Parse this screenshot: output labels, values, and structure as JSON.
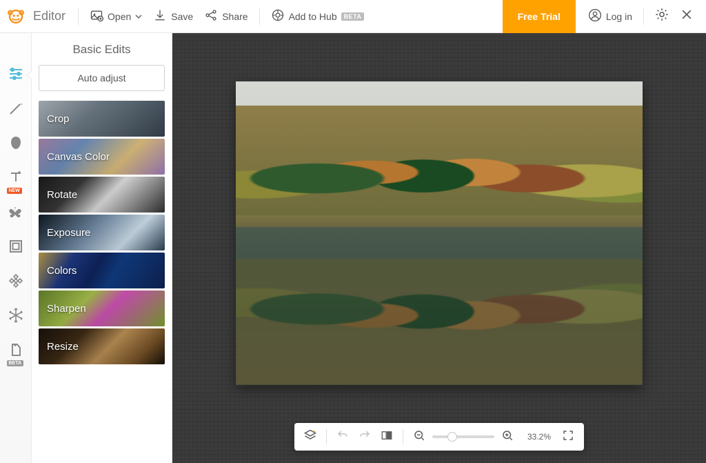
{
  "topbar": {
    "app_name": "Editor",
    "open_label": "Open",
    "save_label": "Save",
    "share_label": "Share",
    "hub_label": "Add to Hub",
    "hub_badge": "BETA",
    "trial_label": "Free Trial",
    "login_label": "Log in"
  },
  "rail": {
    "badges": {
      "new": "NEW",
      "beta": "BETA"
    }
  },
  "panel": {
    "title": "Basic Edits",
    "auto_label": "Auto adjust",
    "tiles": [
      {
        "key": "crop",
        "label": "Crop"
      },
      {
        "key": "canvascolor",
        "label": "Canvas Color"
      },
      {
        "key": "rotate",
        "label": "Rotate"
      },
      {
        "key": "exposure",
        "label": "Exposure"
      },
      {
        "key": "colors",
        "label": "Colors"
      },
      {
        "key": "sharpen",
        "label": "Sharpen"
      },
      {
        "key": "resize",
        "label": "Resize"
      }
    ]
  },
  "bottombar": {
    "zoom_pct": "33.2%"
  },
  "colors": {
    "accent_orange": "#ffa200",
    "active_teal": "#4fbfd7"
  }
}
